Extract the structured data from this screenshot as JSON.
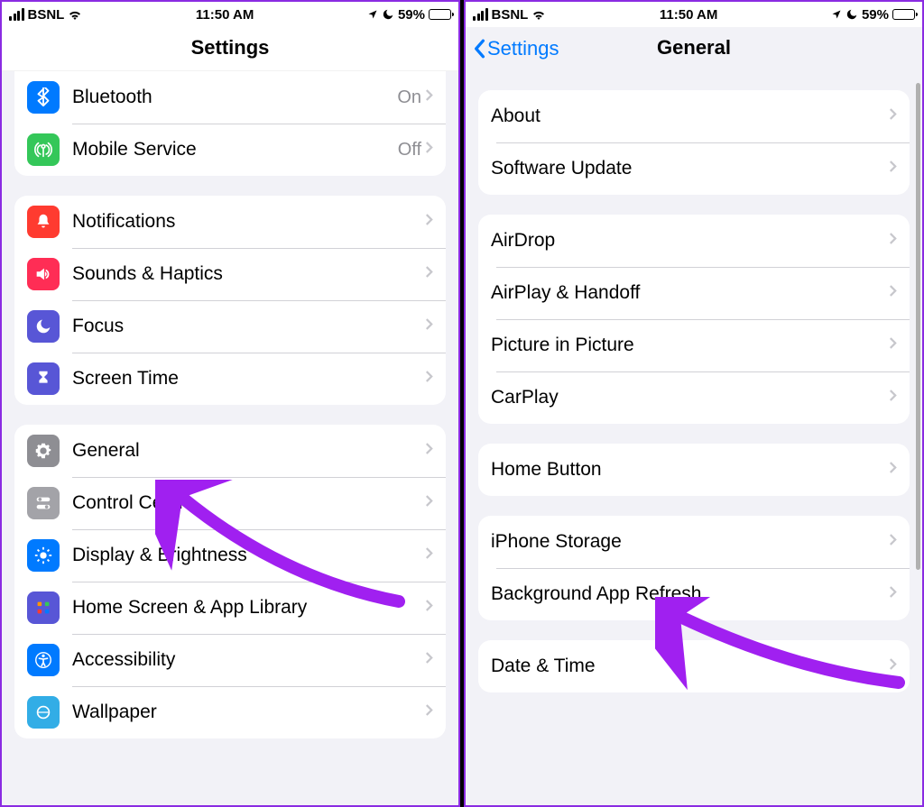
{
  "status": {
    "carrier": "BSNL",
    "time": "11:50 AM",
    "battery_pct": "59%"
  },
  "left": {
    "title": "Settings",
    "group0": [
      {
        "label": "Bluetooth",
        "value": "On"
      },
      {
        "label": "Mobile Service",
        "value": "Off"
      }
    ],
    "group1": [
      {
        "label": "Notifications"
      },
      {
        "label": "Sounds & Haptics"
      },
      {
        "label": "Focus"
      },
      {
        "label": "Screen Time"
      }
    ],
    "group2": [
      {
        "label": "General"
      },
      {
        "label": "Control Centre"
      },
      {
        "label": "Display & Brightness"
      },
      {
        "label": "Home Screen & App Library"
      },
      {
        "label": "Accessibility"
      },
      {
        "label": "Wallpaper"
      }
    ]
  },
  "right": {
    "back": "Settings",
    "title": "General",
    "groupA": [
      {
        "label": "About"
      },
      {
        "label": "Software Update"
      }
    ],
    "groupB": [
      {
        "label": "AirDrop"
      },
      {
        "label": "AirPlay & Handoff"
      },
      {
        "label": "Picture in Picture"
      },
      {
        "label": "CarPlay"
      }
    ],
    "groupC": [
      {
        "label": "Home Button"
      }
    ],
    "groupD": [
      {
        "label": "iPhone Storage"
      },
      {
        "label": "Background App Refresh"
      }
    ],
    "groupE": [
      {
        "label": "Date & Time"
      }
    ]
  }
}
